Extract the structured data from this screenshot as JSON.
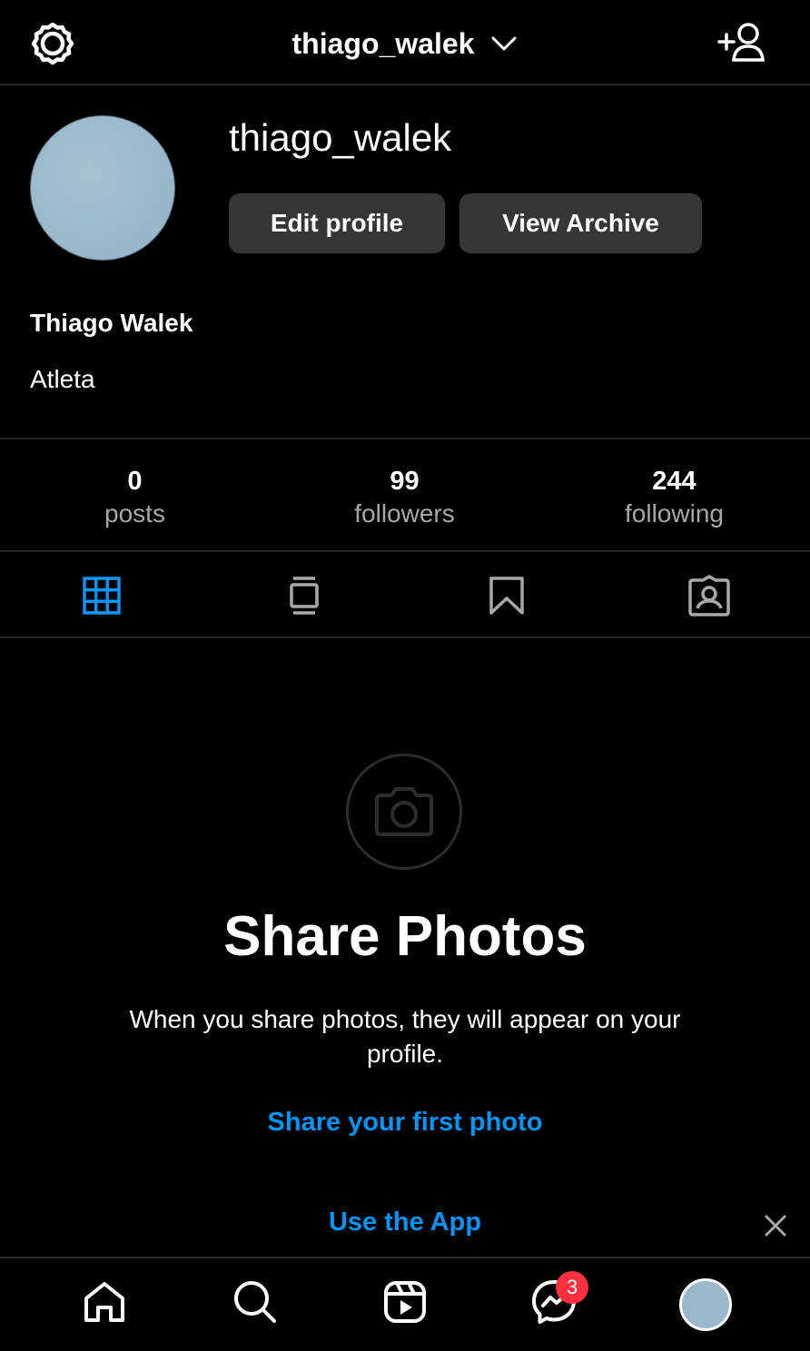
{
  "header": {
    "username": "thiago_walek",
    "settings_icon": "gear-icon",
    "dropdown_icon": "chevron-down-icon",
    "add_user_icon": "add-user-icon"
  },
  "profile": {
    "username": "thiago_walek",
    "edit_label": "Edit profile",
    "archive_label": "View Archive",
    "full_name": "Thiago Walek",
    "bio": "Atleta"
  },
  "stats": [
    {
      "value": "0",
      "label": "posts"
    },
    {
      "value": "99",
      "label": "followers"
    },
    {
      "value": "244",
      "label": "following"
    }
  ],
  "tabs": [
    {
      "icon": "grid-icon",
      "active": true
    },
    {
      "icon": "feed-icon",
      "active": false
    },
    {
      "icon": "bookmark-icon",
      "active": false
    },
    {
      "icon": "tagged-icon",
      "active": false
    }
  ],
  "empty_state": {
    "icon": "camera-icon",
    "title": "Share Photos",
    "description": "When you share photos, they will appear on your profile.",
    "link": "Share your first photo"
  },
  "banner": {
    "text": "Use the App",
    "close_icon": "close-icon"
  },
  "bottom_nav": {
    "items": [
      "home-icon",
      "search-icon",
      "reels-icon",
      "messenger-icon",
      "profile-avatar"
    ],
    "messages_badge": "3"
  },
  "colors": {
    "accent": "#0095f6",
    "background": "#000000",
    "button": "#363636",
    "badge": "#ff3040"
  }
}
